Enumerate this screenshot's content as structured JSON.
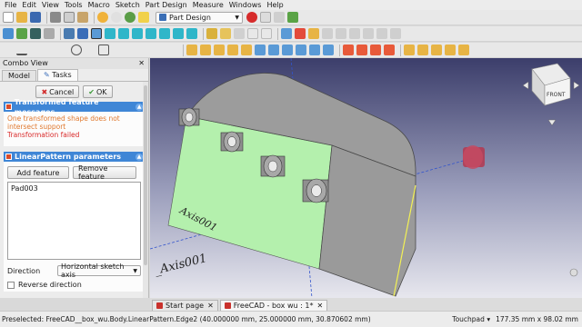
{
  "menu": [
    "File",
    "Edit",
    "View",
    "Tools",
    "Macro",
    "Sketch",
    "Part Design",
    "Measure",
    "Windows",
    "Help"
  ],
  "workbench": {
    "selected": "Part Design"
  },
  "combo_view": {
    "title": "Combo View",
    "tabs": [
      "Model",
      "Tasks"
    ],
    "active_tab": "Tasks"
  },
  "dialog": {
    "cancel_label": "Cancel",
    "ok_label": "OK"
  },
  "messages": {
    "title": "Transformed feature messages",
    "line1": "One transformed shape does not intersect support",
    "line2": "Transformation failed"
  },
  "linear_pattern": {
    "title": "LinearPattern parameters",
    "add_label": "Add feature",
    "remove_label": "Remove feature",
    "features": [
      "Pad003"
    ],
    "direction_label": "Direction",
    "direction_value": "Horizontal sketch axis",
    "reverse_label": "Reverse direction"
  },
  "viewport": {
    "axis_labels": [
      "Axis001",
      "_Axis001"
    ],
    "navcube_face": "FRONT",
    "colors": {
      "body": "#9c9c9c",
      "support": "#b4f0ad",
      "axis": "#3355cc",
      "highlight": "#f3f155",
      "preview": "#b43750"
    }
  },
  "doc_tabs": [
    {
      "label": "Start page",
      "active": false
    },
    {
      "label": "FreeCAD - box wu : 1*",
      "active": true
    }
  ],
  "status": {
    "preselected": "Preselected: FreeCAD__box_wu.Body.LinearPattern.Edge2 (40.000000 mm, 25.000000 mm, 30.870602 mm)",
    "nav_style": "Touchpad",
    "dimensions": "177.35 mm x 98.02 mm"
  }
}
